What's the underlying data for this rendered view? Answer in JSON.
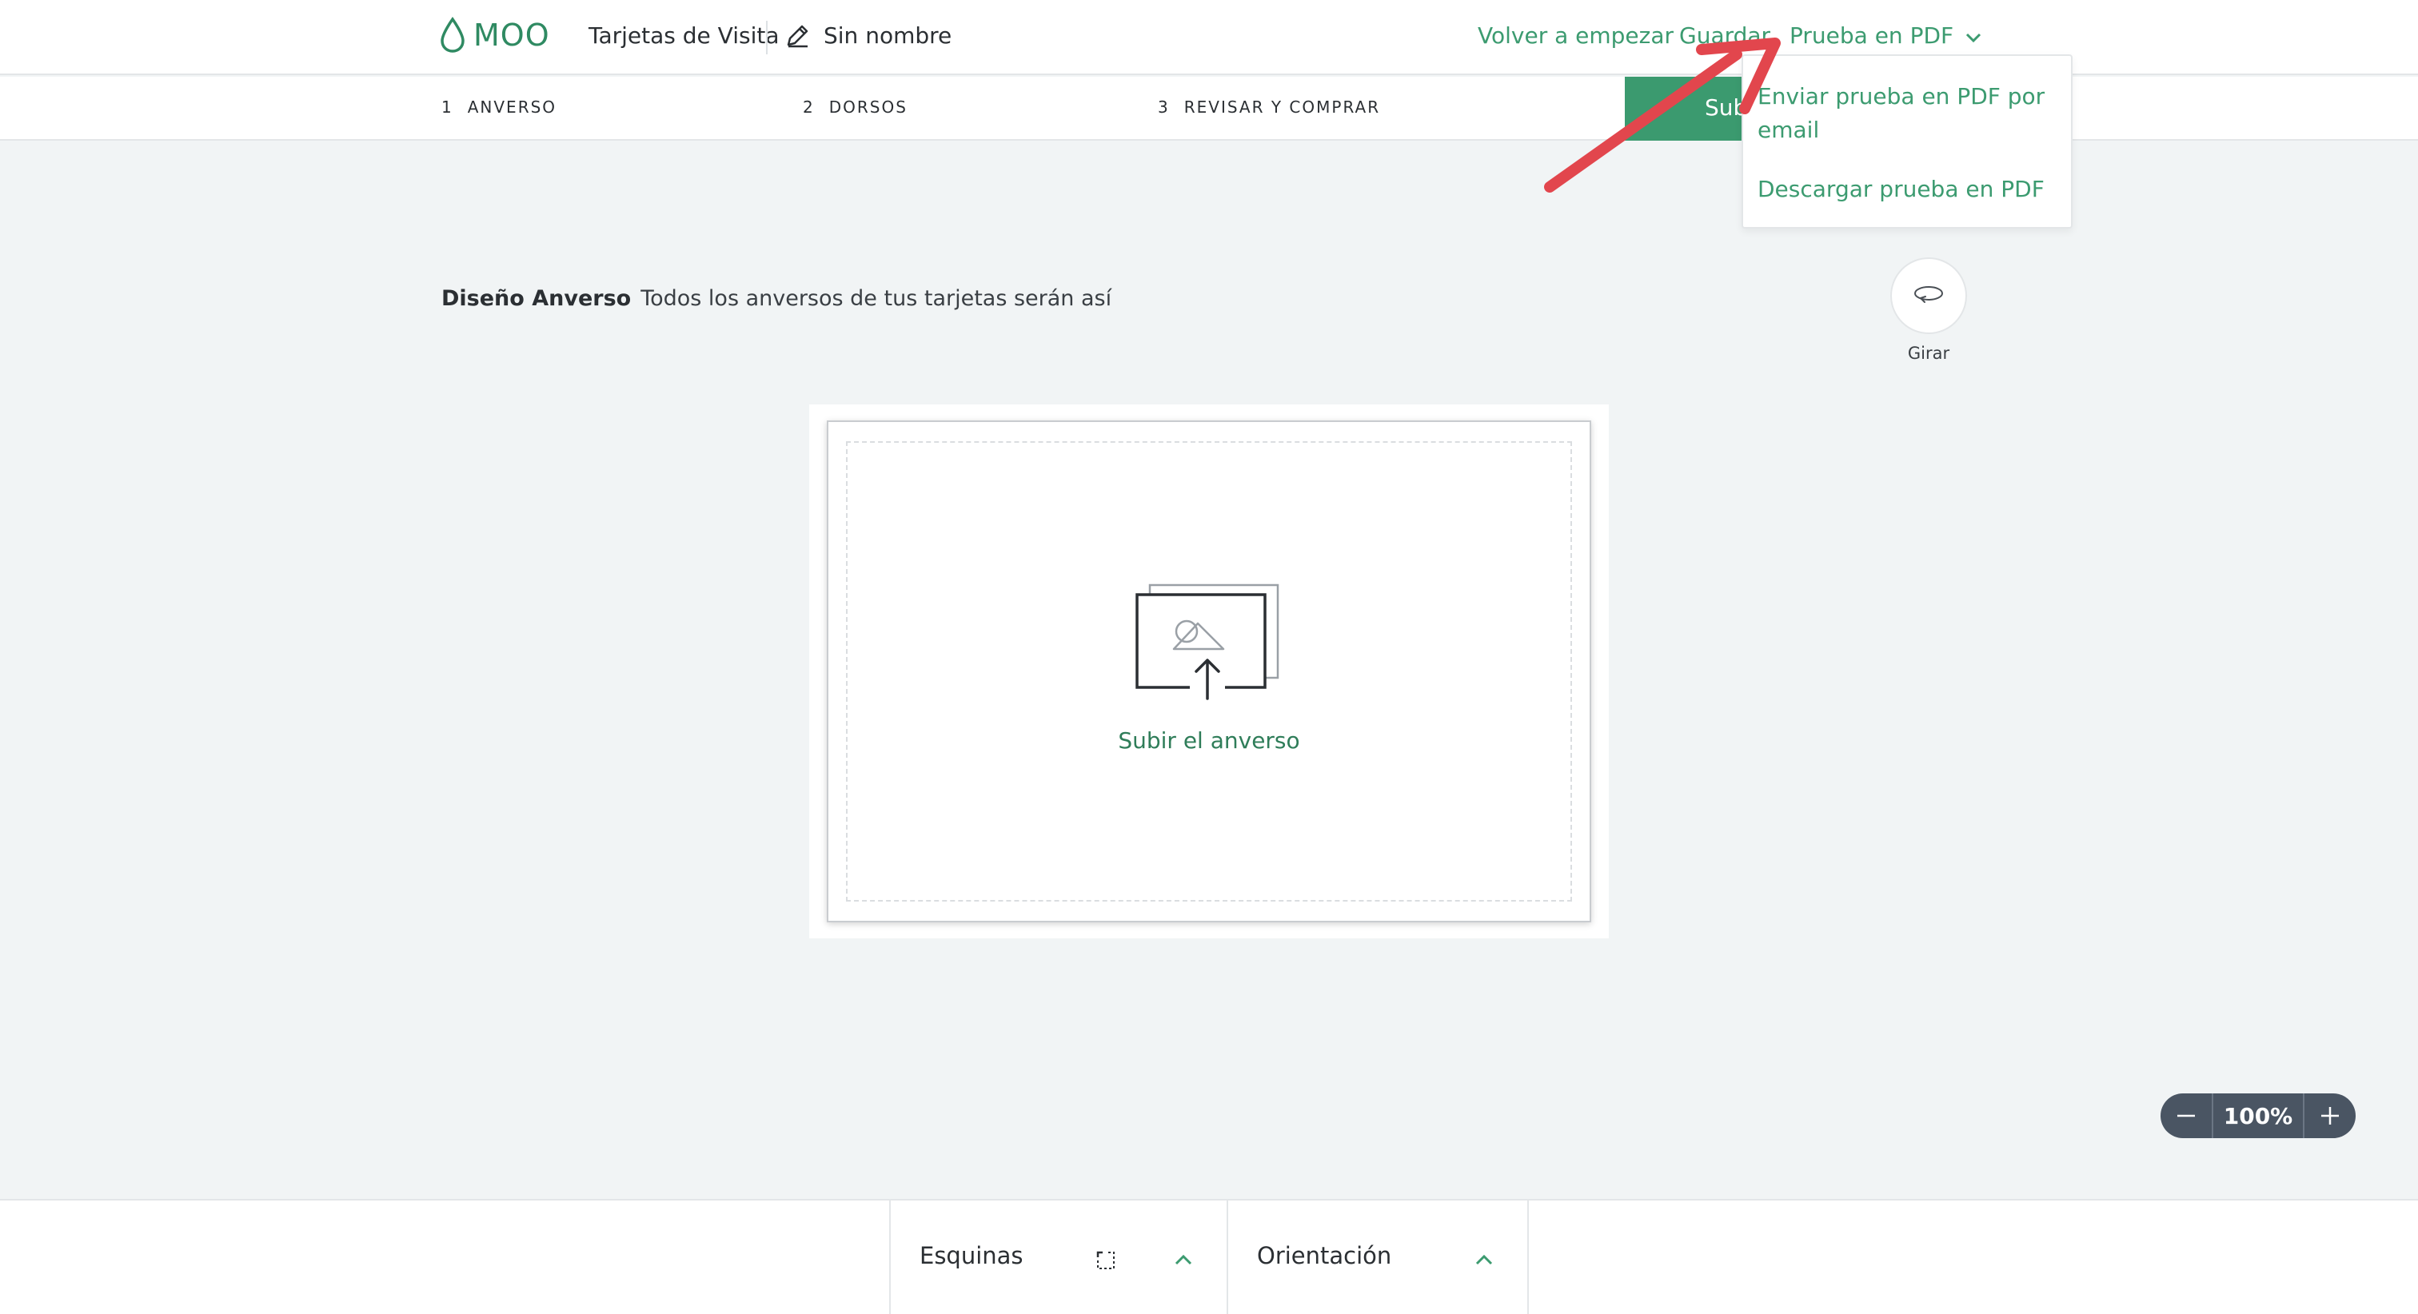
{
  "header": {
    "logo_text": "MOO",
    "product_name": "Tarjetas de Visita",
    "design_name": "Sin nombre",
    "restart_label": "Volver a empezar",
    "save_label": "Guardar",
    "pdf_label": "Prueba en PDF"
  },
  "pdf_menu": {
    "email_label": "Enviar prueba en PDF por email",
    "download_label": "Descargar prueba en PDF"
  },
  "steps": [
    {
      "number": "1",
      "label": "ANVERSO"
    },
    {
      "number": "2",
      "label": "DORSOS"
    },
    {
      "number": "3",
      "label": "REVISAR Y COMPRAR"
    }
  ],
  "upload_button_label": "Subir",
  "design": {
    "title": "Diseño Anverso",
    "description": "Todos los anversos de tus tarjetas serán así"
  },
  "rotate_label": "Girar",
  "card": {
    "upload_label": "Subir el anverso"
  },
  "zoom": {
    "value": "100%"
  },
  "bottom_panels": {
    "corners_label": "Esquinas",
    "orientation_label": "Orientación"
  },
  "colors": {
    "brand_green": "#3b9a6f",
    "link_green": "#3c9b70",
    "annotation_red": "#e2464d",
    "zoom_bg": "#4a5563"
  },
  "icons": {
    "logo": "drop-icon",
    "edit": "pencil-icon",
    "pdf_dropdown": "chevron-down-icon",
    "rotate": "rotate-icon",
    "upload": "image-upload-icon",
    "zoom_out": "minus-icon",
    "zoom_in": "plus-icon",
    "corners": "corners-icon",
    "expand": "chevron-up-icon",
    "annotation": "red-arrow-icon"
  }
}
